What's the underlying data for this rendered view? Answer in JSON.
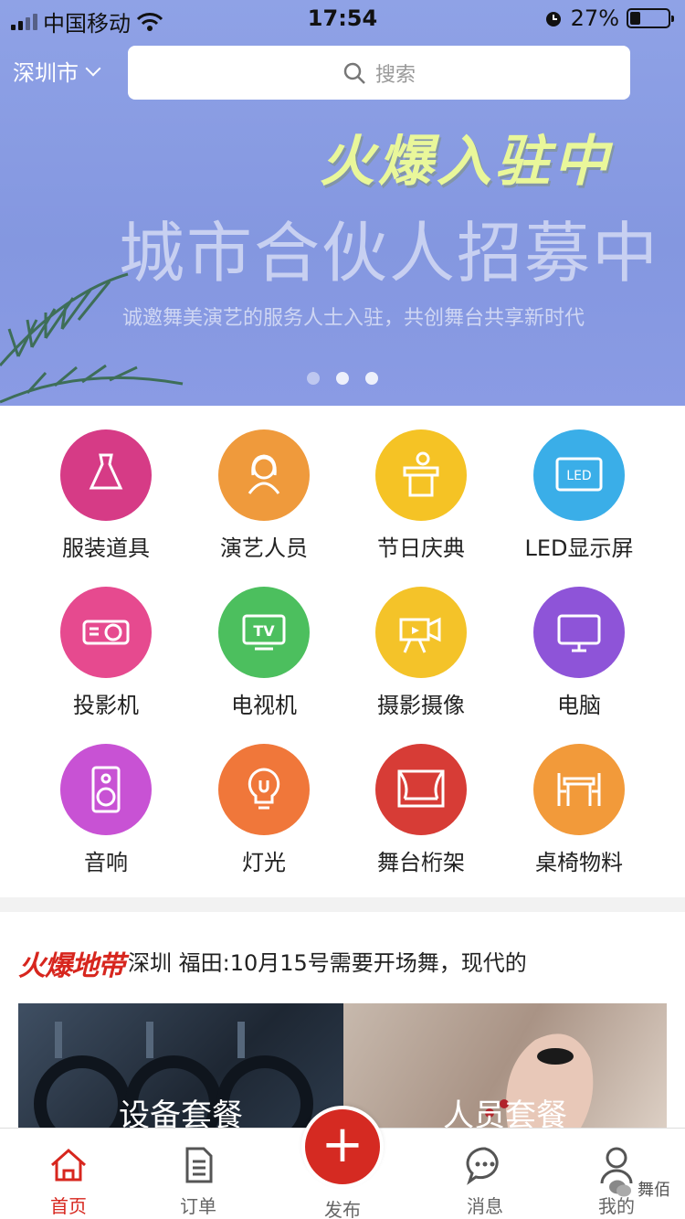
{
  "status_bar": {
    "carrier": "中国移动",
    "time": "17:54",
    "battery_percent": "27%",
    "battery_level": 0.27
  },
  "header": {
    "city": "深圳市",
    "search_placeholder": "搜索"
  },
  "banner": {
    "headline": "火爆入驻中",
    "title": "城市合伙人招募中",
    "subtitle": "诚邀舞美演艺的服务人士入驻，共创舞台共享新时代",
    "slide_count": 3,
    "active_slide": 0
  },
  "categories": [
    {
      "label": "服装道具",
      "color": "#d63b86",
      "icon": "dress-icon"
    },
    {
      "label": "演艺人员",
      "color": "#ef9a3c",
      "icon": "performer-icon"
    },
    {
      "label": "节日庆典",
      "color": "#f5c325",
      "icon": "podium-icon"
    },
    {
      "label": "LED显示屏",
      "color": "#3aaee8",
      "icon": "led-screen-icon"
    },
    {
      "label": "投影机",
      "color": "#e64a8f",
      "icon": "projector-icon"
    },
    {
      "label": "电视机",
      "color": "#4cbf5e",
      "icon": "tv-icon"
    },
    {
      "label": "摄影摄像",
      "color": "#f4c329",
      "icon": "camera-icon"
    },
    {
      "label": "电脑",
      "color": "#8e54d8",
      "icon": "monitor-icon"
    },
    {
      "label": "音响",
      "color": "#c852d4",
      "icon": "speaker-icon"
    },
    {
      "label": "灯光",
      "color": "#f0773a",
      "icon": "bulb-icon"
    },
    {
      "label": "舞台桁架",
      "color": "#d73c36",
      "icon": "stage-icon"
    },
    {
      "label": "桌椅物料",
      "color": "#f29a3a",
      "icon": "table-chair-icon"
    }
  ],
  "hot": {
    "logo": "火爆地带",
    "message": "深圳 福田:10月15号需要开场舞，现代的",
    "packages": [
      {
        "label": "设备套餐"
      },
      {
        "label": "人员套餐"
      }
    ]
  },
  "tabs": {
    "home": "首页",
    "orders": "订单",
    "publish": "发布",
    "messages": "消息",
    "mine": "我的"
  },
  "watermark": "舞佰",
  "colors": {
    "brand_red": "#d52a22",
    "banner_blue": "#8a9be4",
    "headline_yellow": "#e9f79a"
  }
}
